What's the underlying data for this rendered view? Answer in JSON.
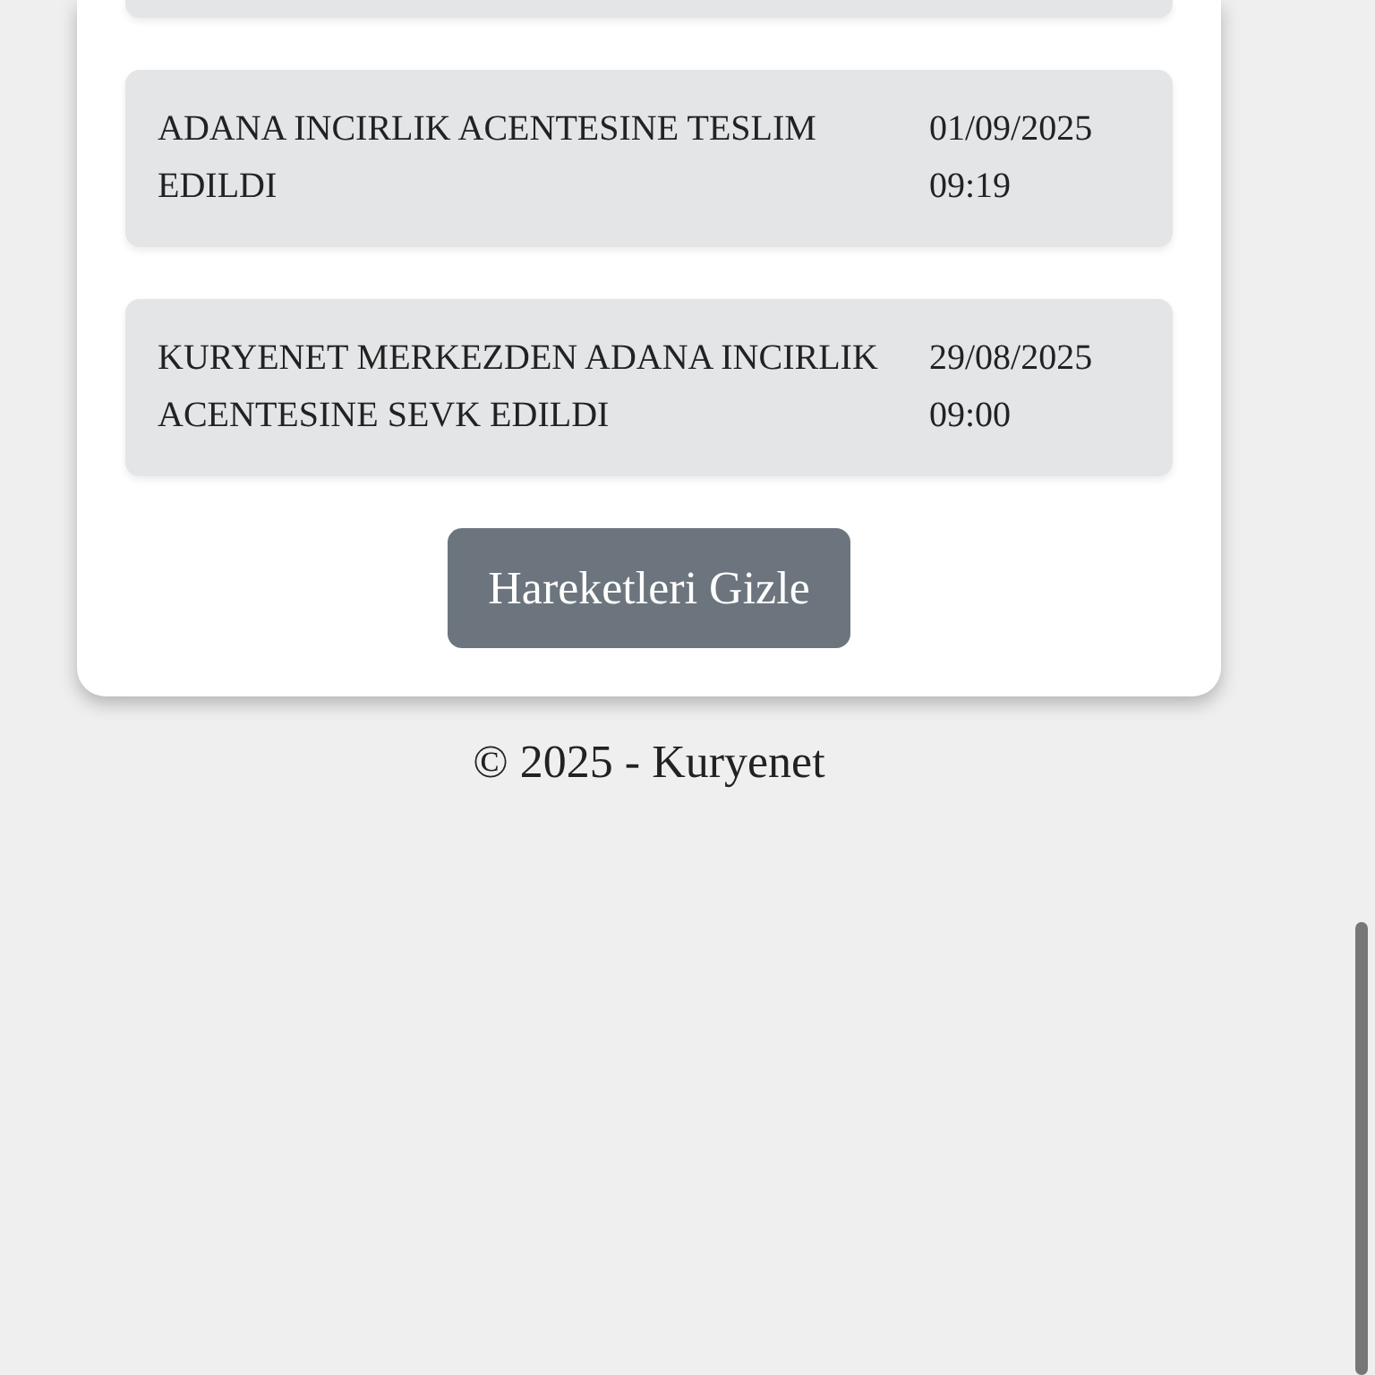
{
  "movements": [
    {
      "description": "ADANA INCIRLIK ACENTESINE TESLIM EDILDI",
      "date": "01/09/2025",
      "time": "09:19"
    },
    {
      "description": "KURYENET MERKEZDEN ADANA INCIRLIK ACENTESINE SEVK EDILDI",
      "date": "29/08/2025",
      "time": "09:00"
    }
  ],
  "toggle_button": "Hareketleri Gizle",
  "footer": "© 2025 - Kuryenet"
}
